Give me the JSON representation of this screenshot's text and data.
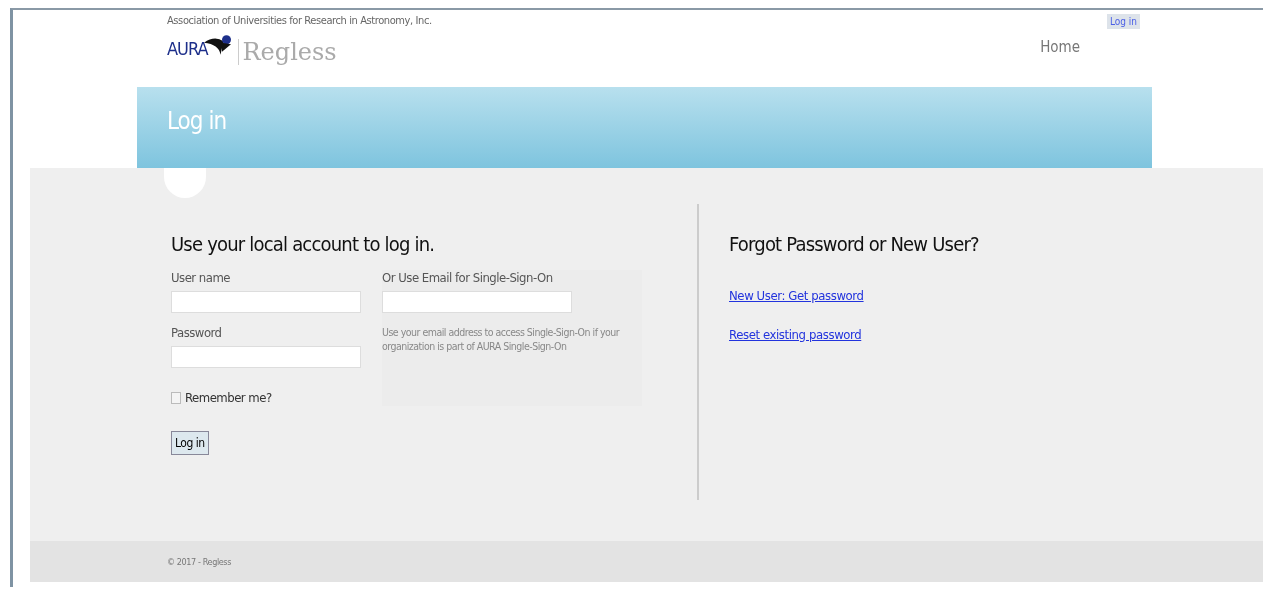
{
  "header": {
    "tagline": "Association of Universities for Research in Astronomy, Inc.",
    "logo_text": "AURA",
    "app_name": "Regless",
    "login_link": "Log in",
    "nav": [
      "Home"
    ]
  },
  "banner": {
    "title": "Log in"
  },
  "login": {
    "heading": "Use your local account to log in.",
    "username_label": "User name",
    "password_label": "Password",
    "remember": {
      "label": "Remember me?",
      "checked": false
    },
    "button": "Log in",
    "sso_label": "Or Use Email for Single-Sign-On",
    "sso_help": "Use your email address to access Single-Sign-On if your organization is part of AURA Single-Sign-On"
  },
  "help": {
    "heading": "Forgot Password or New User?",
    "links": [
      "New User: Get password",
      "Reset existing password"
    ]
  },
  "footer": {
    "text": "© 2017 - Regless"
  }
}
